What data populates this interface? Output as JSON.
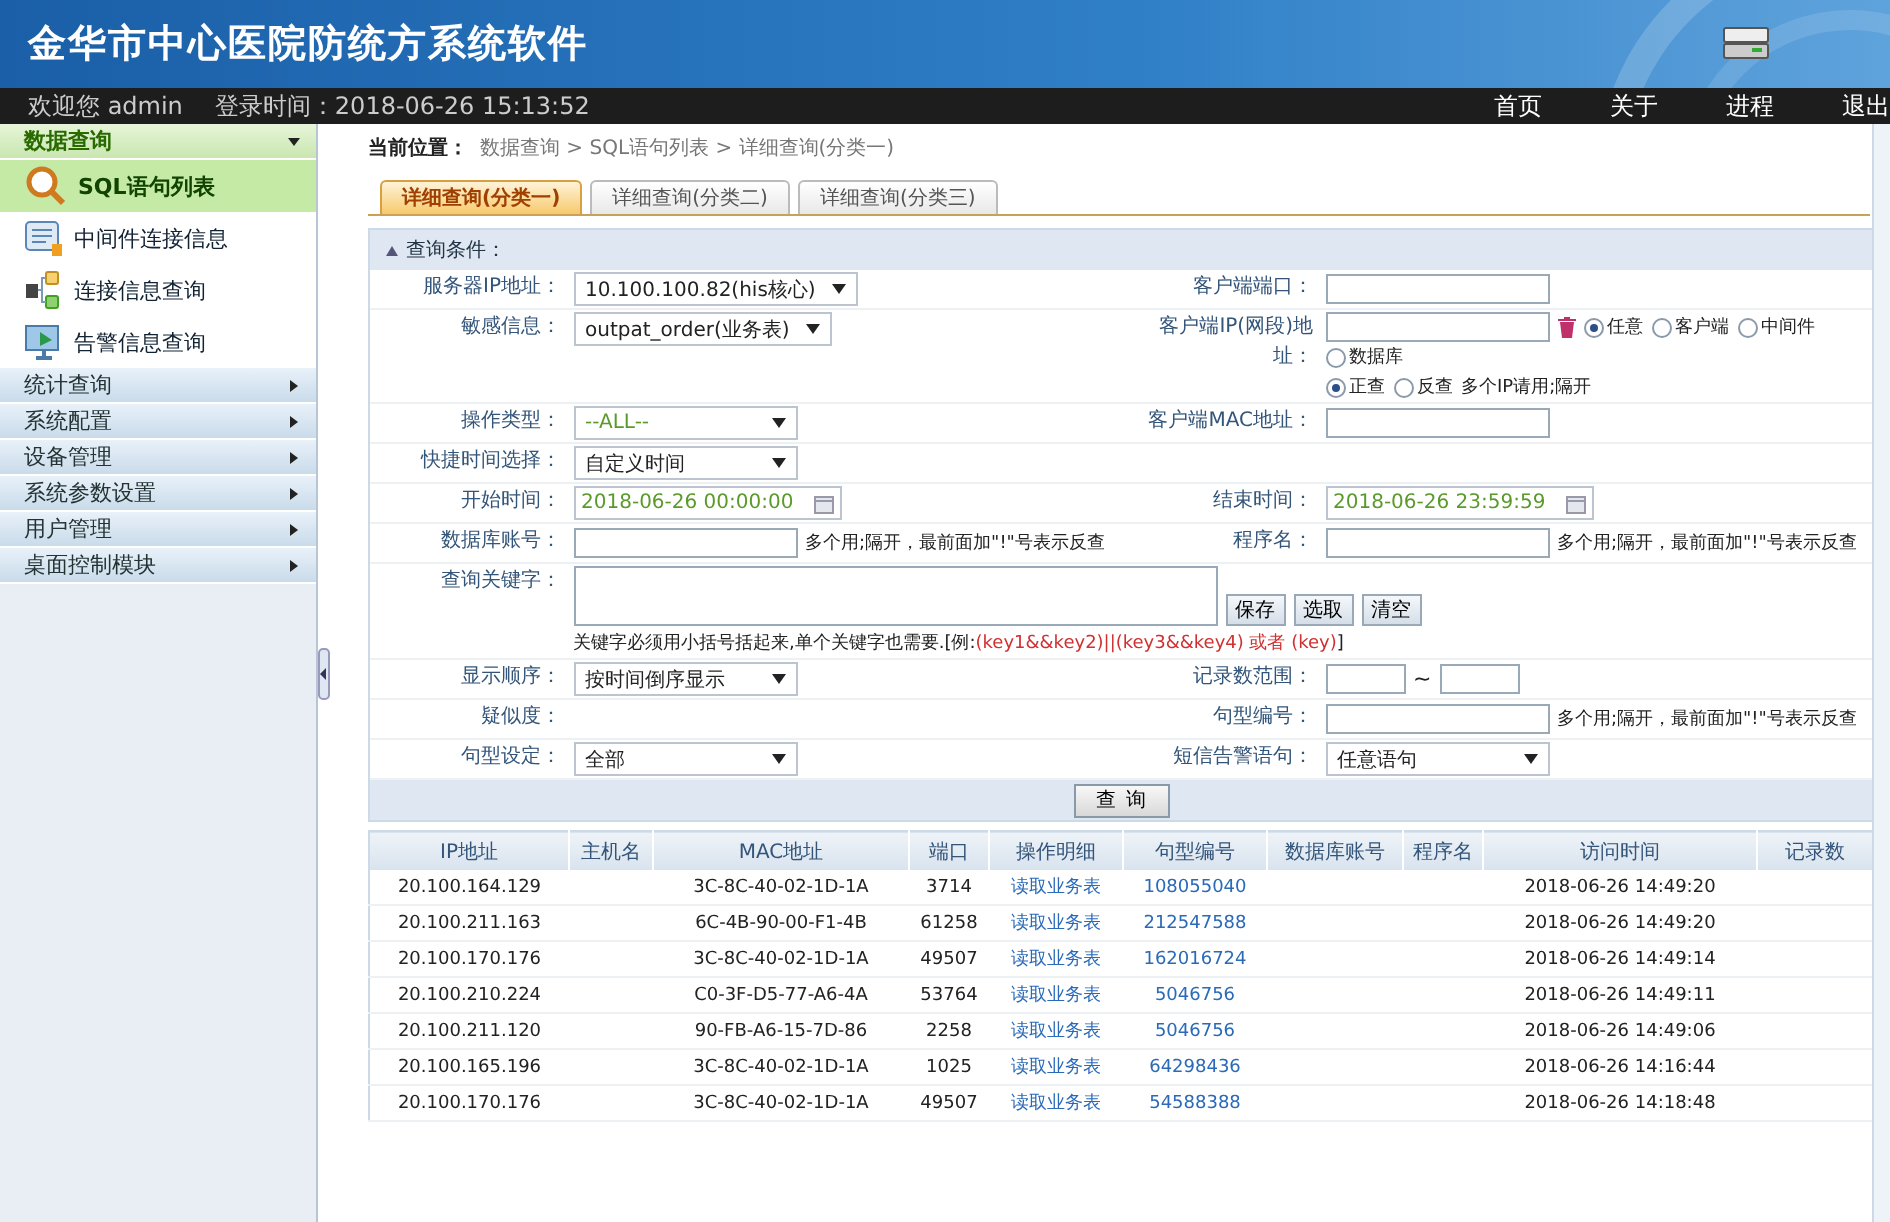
{
  "header": {
    "title": "金华市中心医院防统方系统软件"
  },
  "topbar": {
    "greeting": "欢迎您 admin",
    "login_time": "登录时间：2018-06-26 15:13:52",
    "nav": [
      "首页",
      "关于",
      "进程",
      "退出"
    ]
  },
  "sidebar": {
    "sections": [
      {
        "label": "数据查询",
        "expanded": true,
        "items": [
          {
            "label": "SQL语句列表",
            "selected": true
          },
          {
            "label": "中间件连接信息",
            "selected": false
          },
          {
            "label": "连接信息查询",
            "selected": false
          },
          {
            "label": "告警信息查询",
            "selected": false
          }
        ]
      },
      {
        "label": "统计查询",
        "expanded": false
      },
      {
        "label": "系统配置",
        "expanded": false
      },
      {
        "label": "设备管理",
        "expanded": false
      },
      {
        "label": "系统参数设置",
        "expanded": false
      },
      {
        "label": "用户管理",
        "expanded": false
      },
      {
        "label": "桌面控制模块",
        "expanded": false
      }
    ]
  },
  "breadcrumb": {
    "label": "当前位置：",
    "path": "数据查询 > SQL语句列表 > 详细查询(分类一)"
  },
  "tabs": [
    {
      "label": "详细查询(分类一)",
      "selected": true
    },
    {
      "label": "详细查询(分类二)",
      "selected": false
    },
    {
      "label": "详细查询(分类三)",
      "selected": false
    }
  ],
  "query": {
    "title": "查询条件：",
    "submit": "查 询",
    "rows": [
      {
        "left": {
          "label": "服务器IP地址：",
          "controls": [
            {
              "kind": "select",
              "value": "10.100.100.82(his核心)",
              "muted": false
            }
          ]
        },
        "right": {
          "label": "客户端端口：",
          "controls": [
            {
              "kind": "input"
            }
          ]
        }
      },
      {
        "left": {
          "label": "敏感信息：",
          "controls": [
            {
              "kind": "select",
              "value": "outpat_order(业务表)",
              "muted": false
            }
          ]
        },
        "right": {
          "label": "客户端IP(网段)地址：",
          "controls": [
            {
              "kind": "input"
            },
            {
              "kind": "trash"
            },
            {
              "kind": "radio",
              "label": "任意",
              "selected": true
            },
            {
              "kind": "radio",
              "label": "客户端",
              "selected": false
            },
            {
              "kind": "radio",
              "label": "中间件",
              "selected": false
            },
            {
              "kind": "radio",
              "label": "数据库",
              "selected": false
            },
            {
              "kind": "break"
            },
            {
              "kind": "radio",
              "label": "正查",
              "selected": true
            },
            {
              "kind": "radio",
              "label": "反查",
              "selected": false
            },
            {
              "kind": "hint",
              "text": "多个IP请用;隔开"
            }
          ]
        }
      },
      {
        "left": {
          "label": "操作类型：",
          "controls": [
            {
              "kind": "select",
              "value": "--ALL--",
              "muted": true
            }
          ]
        },
        "right": {
          "label": "客户端MAC地址：",
          "controls": [
            {
              "kind": "input"
            }
          ]
        }
      },
      {
        "left": {
          "label": "快捷时间选择：",
          "controls": [
            {
              "kind": "select",
              "value": "自定义时间",
              "muted": false
            }
          ]
        },
        "right": {}
      },
      {
        "left": {
          "label": "开始时间：",
          "controls": [
            {
              "kind": "date",
              "value": "2018-06-26 00:00:00"
            }
          ]
        },
        "right": {
          "label": "结束时间：",
          "controls": [
            {
              "kind": "date",
              "value": "2018-06-26 23:59:59"
            }
          ]
        }
      },
      {
        "left": {
          "label": "数据库账号：",
          "controls": [
            {
              "kind": "input"
            },
            {
              "kind": "hint",
              "text": "多个用;隔开，最前面加\"!\"号表示反查"
            }
          ]
        },
        "right": {
          "label": "程序名：",
          "controls": [
            {
              "kind": "input"
            },
            {
              "kind": "hint",
              "text": "多个用;隔开，最前面加\"!\"号表示反查"
            }
          ]
        }
      },
      {
        "full": {
          "label": "查询关键字：",
          "controls": [
            {
              "kind": "textarea"
            },
            {
              "kind": "button",
              "label": "保存"
            },
            {
              "kind": "button",
              "label": "选取"
            },
            {
              "kind": "button",
              "label": "清空"
            },
            {
              "kind": "break"
            },
            {
              "kind": "keyhint",
              "text": "关键字必须用小括号括起来,单个关键字也需要.[例:",
              "example": "(key1&&key2)||(key3&&key4) 或者 (key)",
              "end": "]"
            }
          ]
        }
      },
      {
        "left": {
          "label": "显示顺序：",
          "controls": [
            {
              "kind": "select",
              "value": "按时间倒序显示",
              "muted": false
            }
          ]
        },
        "right": {
          "label": "记录数范围：",
          "controls": [
            {
              "kind": "range",
              "separator": "~"
            }
          ]
        }
      },
      {
        "left": {
          "label": "疑似度："
        },
        "right": {
          "label": "句型编号：",
          "controls": [
            {
              "kind": "input"
            },
            {
              "kind": "hint",
              "text": "多个用;隔开，最前面加\"!\"号表示反查"
            }
          ]
        }
      },
      {
        "left": {
          "label": "句型设定：",
          "controls": [
            {
              "kind": "select",
              "value": "全部",
              "muted": false
            }
          ]
        },
        "right": {
          "label": "短信告警语句：",
          "controls": [
            {
              "kind": "select",
              "value": "任意语句",
              "muted": false
            }
          ]
        }
      }
    ]
  },
  "table": {
    "columns": [
      {
        "label": "IP地址",
        "kind": "text"
      },
      {
        "label": "主机名",
        "kind": "text"
      },
      {
        "label": "MAC地址",
        "kind": "text"
      },
      {
        "label": "端口",
        "kind": "text"
      },
      {
        "label": "操作明细",
        "kind": "link"
      },
      {
        "label": "句型编号",
        "kind": "link"
      },
      {
        "label": "数据库账号",
        "kind": "text"
      },
      {
        "label": "程序名",
        "kind": "text"
      },
      {
        "label": "访问时间",
        "kind": "text"
      },
      {
        "label": "记录数",
        "kind": "text"
      }
    ],
    "rows": [
      [
        "20.100.164.129",
        "",
        "3C-8C-40-02-1D-1A",
        "3714",
        "读取业务表",
        "108055040",
        "",
        "",
        "2018-06-26 14:49:20",
        ""
      ],
      [
        "20.100.211.163",
        "",
        "6C-4B-90-00-F1-4B",
        "61258",
        "读取业务表",
        "212547588",
        "",
        "",
        "2018-06-26 14:49:20",
        ""
      ],
      [
        "20.100.170.176",
        "",
        "3C-8C-40-02-1D-1A",
        "49507",
        "读取业务表",
        "162016724",
        "",
        "",
        "2018-06-26 14:49:14",
        ""
      ],
      [
        "20.100.210.224",
        "",
        "C0-3F-D5-77-A6-4A",
        "53764",
        "读取业务表",
        "5046756",
        "",
        "",
        "2018-06-26 14:49:11",
        ""
      ],
      [
        "20.100.211.120",
        "",
        "90-FB-A6-15-7D-86",
        "2258",
        "读取业务表",
        "5046756",
        "",
        "",
        "2018-06-26 14:49:06",
        ""
      ],
      [
        "20.100.165.196",
        "",
        "3C-8C-40-02-1D-1A",
        "1025",
        "读取业务表",
        "64298436",
        "",
        "",
        "2018-06-26 14:16:44",
        ""
      ],
      [
        "20.100.170.176",
        "",
        "3C-8C-40-02-1D-1A",
        "49507",
        "读取业务表",
        "54588388",
        "",
        "",
        "2018-06-26 14:18:48",
        ""
      ]
    ]
  }
}
